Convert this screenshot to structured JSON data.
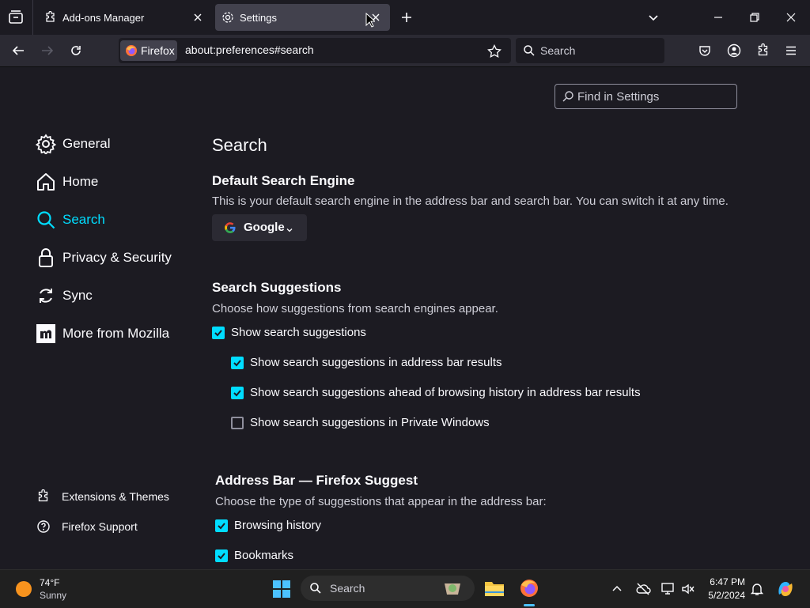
{
  "tabs": [
    {
      "label": "Add-ons Manager",
      "icon": "puzzle-icon",
      "active": false
    },
    {
      "label": "Settings",
      "icon": "gear-icon",
      "active": true
    }
  ],
  "navbar": {
    "identity_label": "Firefox",
    "url": "about:preferences#search",
    "search_placeholder": "Search"
  },
  "find_in_settings": "Find in Settings",
  "sidebar": {
    "items": [
      {
        "label": "General",
        "icon": "gear-icon"
      },
      {
        "label": "Home",
        "icon": "home-icon"
      },
      {
        "label": "Search",
        "icon": "search-icon",
        "selected": true
      },
      {
        "label": "Privacy & Security",
        "icon": "lock-icon"
      },
      {
        "label": "Sync",
        "icon": "sync-icon"
      },
      {
        "label": "More from Mozilla",
        "icon": "mozilla-icon"
      }
    ],
    "footer": [
      {
        "label": "Extensions & Themes",
        "icon": "puzzle-icon"
      },
      {
        "label": "Firefox Support",
        "icon": "help-icon"
      }
    ]
  },
  "main": {
    "title": "Search",
    "default_engine": {
      "heading": "Default Search Engine",
      "description": "This is your default search engine in the address bar and search bar. You can switch it at any time.",
      "selected": "Google"
    },
    "suggestions": {
      "heading": "Search Suggestions",
      "description": "Choose how suggestions from search engines appear.",
      "options": [
        {
          "label": "Show search suggestions",
          "checked": true
        },
        {
          "label": "Show search suggestions in address bar results",
          "checked": true
        },
        {
          "label": "Show search suggestions ahead of browsing history in address bar results",
          "checked": true
        },
        {
          "label": "Show search suggestions in Private Windows",
          "checked": false
        }
      ]
    },
    "address_bar": {
      "heading": "Address Bar — Firefox Suggest",
      "description": "Choose the type of suggestions that appear in the address bar:",
      "options": [
        {
          "label": "Browsing history",
          "checked": true
        },
        {
          "label": "Bookmarks",
          "checked": true
        }
      ]
    }
  },
  "taskbar": {
    "weather_temp": "74°F",
    "weather_desc": "Sunny",
    "search_placeholder": "Search",
    "time": "6:47 PM",
    "date": "5/2/2024"
  },
  "colors": {
    "accent": "#00ddff",
    "background": "#1c1b22",
    "toolbar": "#2b2a33"
  }
}
